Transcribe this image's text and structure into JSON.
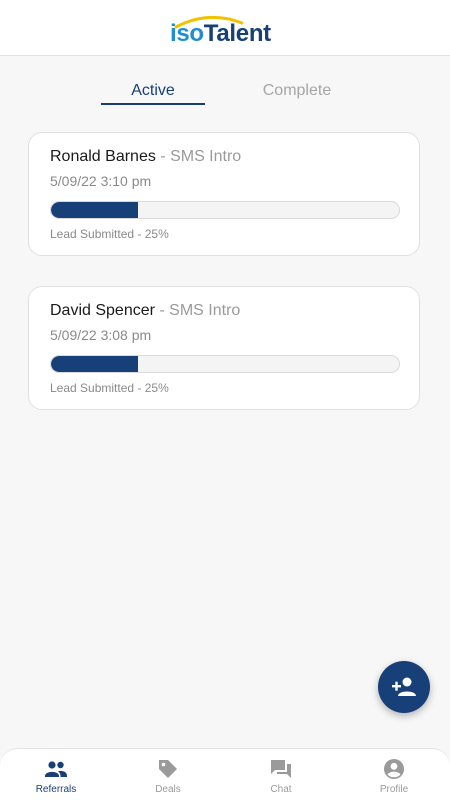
{
  "header": {
    "logo_iso": "iso",
    "logo_talent": "Talent"
  },
  "tabs": [
    {
      "label": "Active",
      "selected": true
    },
    {
      "label": "Complete",
      "selected": false
    }
  ],
  "referrals": [
    {
      "name": "Ronald Barnes",
      "separator": " - ",
      "type": "SMS Intro",
      "date": "5/09/22 3:10 pm",
      "progress": 0.25,
      "status": "Lead Submitted - 25%"
    },
    {
      "name": "David Spencer",
      "separator": " - ",
      "type": "SMS Intro",
      "date": "5/09/22 3:08 pm",
      "progress": 0.25,
      "status": "Lead Submitted - 25%"
    }
  ],
  "fab": {
    "icon": "add-person-icon"
  },
  "nav": [
    {
      "label": "Referrals",
      "icon": "people-icon",
      "active": true
    },
    {
      "label": "Deals",
      "icon": "tag-icon",
      "active": false
    },
    {
      "label": "Chat",
      "icon": "chat-icon",
      "active": false
    },
    {
      "label": "Profile",
      "icon": "account-circle-icon",
      "active": false
    }
  ],
  "colors": {
    "primary": "#173f78",
    "logo_iso": "#1d8fd0",
    "logo_arc": "#f2c200",
    "muted": "#9a9a9a"
  }
}
